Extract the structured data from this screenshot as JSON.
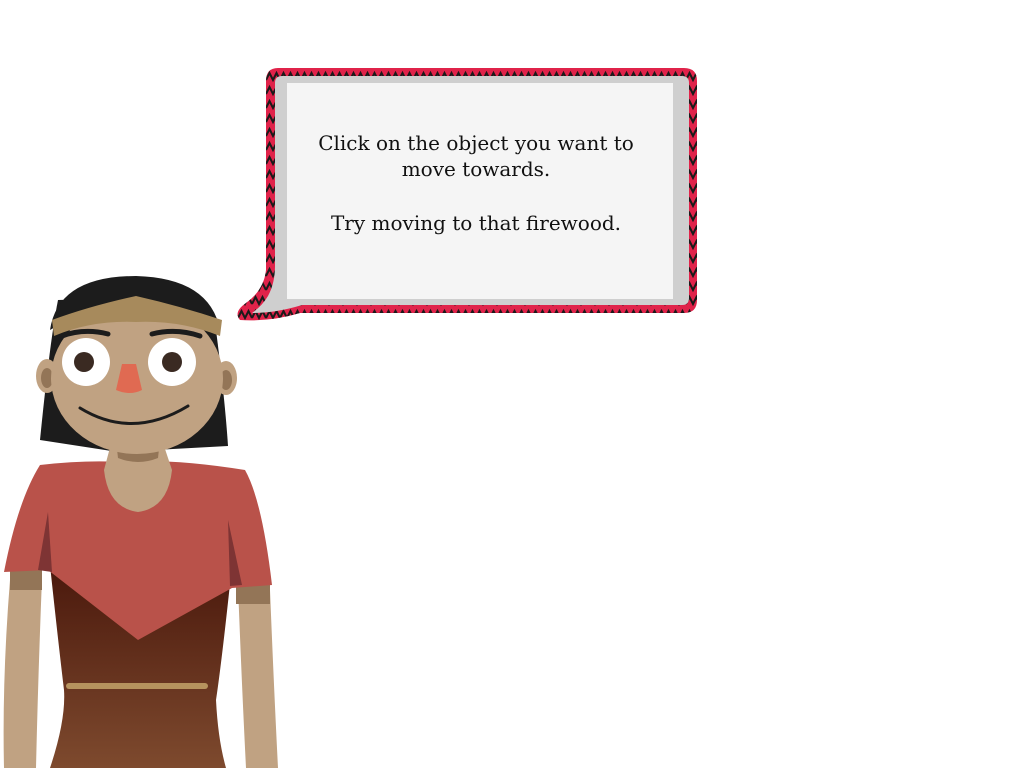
{
  "dialog": {
    "line1": "Click on the object you want to move towards.",
    "line2": "Try moving to that firewood."
  },
  "colors": {
    "bubble_border": "#e0234a",
    "bubble_zigzag": "#1a1a1a",
    "bubble_fill": "#f5f5f5",
    "bubble_shadow": "#cfcfcf",
    "skin": "#c0a282",
    "hair": "#1c1c1c",
    "headband": "#a78a5c",
    "shirt": "#b9524a",
    "dress": "#5a2616",
    "nose": "#e06a52"
  },
  "character": {
    "icon": "guide-character-icon"
  }
}
